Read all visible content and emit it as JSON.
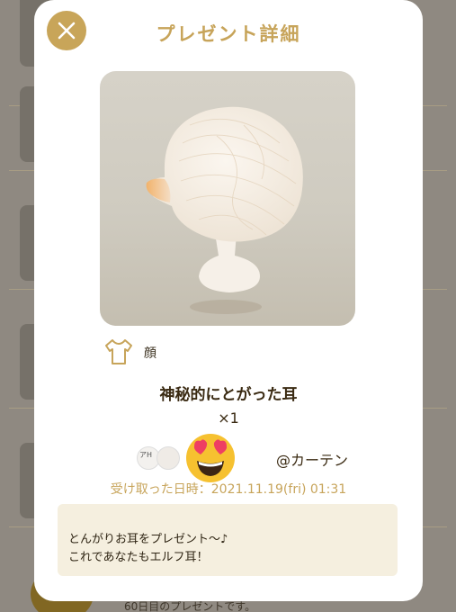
{
  "modal": {
    "title": "プレゼント詳細",
    "close_icon": "close-icon",
    "item": {
      "category_icon": "shirt-icon",
      "category": "顔",
      "name": "神秘的にとがった耳",
      "quantity": "×1"
    },
    "sender": {
      "avatar_text": "アH",
      "name": "@カーテン",
      "emoji_icon": "heart-eyes-emoji-icon"
    },
    "received_at": "受け取った日時：2021.11.19(fri) 01:31",
    "message": {
      "line1": "とんがりお耳をプレゼント〜♪",
      "line2": "これであなたもエルフ耳！"
    }
  },
  "background": {
    "last_row_text": "60日目のプレゼントです。"
  },
  "colors": {
    "accent": "#c8a559",
    "message_bg": "#f5efdf",
    "text_dark": "#3a2a12"
  }
}
